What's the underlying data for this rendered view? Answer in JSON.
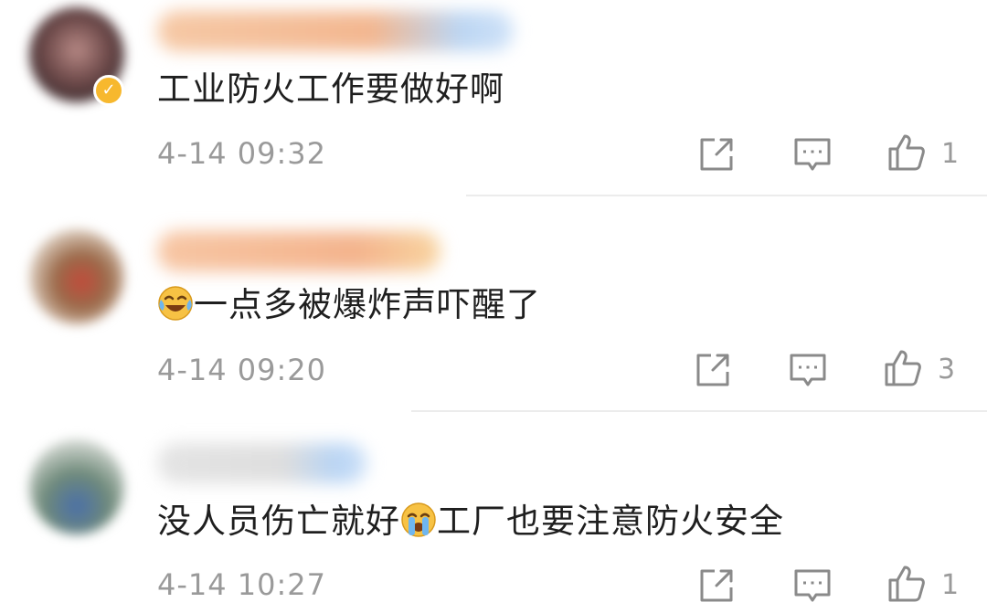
{
  "comments": [
    {
      "username": "",
      "text": "工业防火工作要做好啊",
      "timestamp": "4-14 09:32",
      "like_count": "1",
      "verified_badge": "✓"
    },
    {
      "username": "",
      "text": "一点多被爆炸声吓醒了",
      "emoji_prefix": "laugh-cry-emoji",
      "timestamp": "4-14 09:20",
      "like_count": "3"
    },
    {
      "username": "",
      "text_before": "没人员伤亡就好",
      "emoji_inline": "crying-emoji",
      "text_after": "工厂也要注意防火安全",
      "timestamp": "4-14 10:27",
      "like_count": "1"
    }
  ],
  "icons": {
    "repost": "share-square-icon",
    "reply": "comment-bubble-icon",
    "like": "thumbs-up-icon"
  },
  "colors": {
    "text": "#1f1f1f",
    "meta": "#9a9a9a",
    "divider": "#ececec",
    "badge": "#f7b82e"
  }
}
